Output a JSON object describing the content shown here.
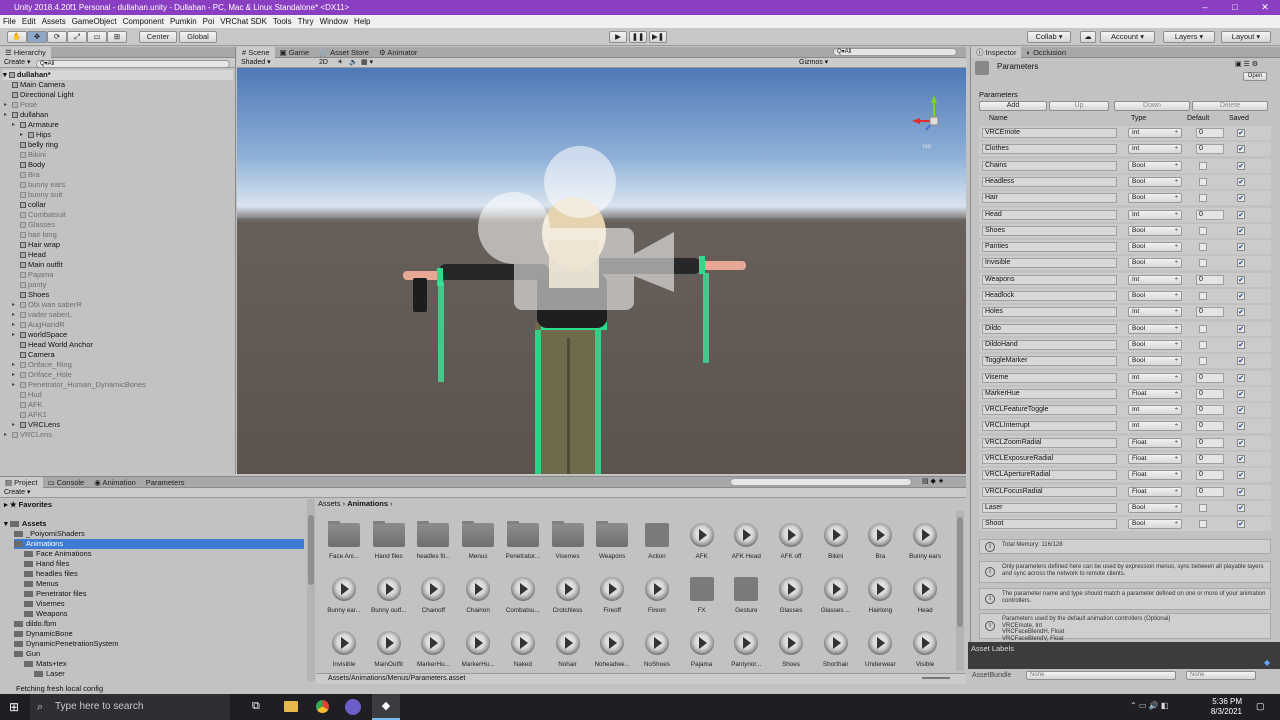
{
  "window": {
    "title": "Unity 2018.4.20f1 Personal - dullahan.unity - Dullahan - PC, Mac & Linux Standalone* <DX11>"
  },
  "menu": [
    "File",
    "Edit",
    "Assets",
    "GameObject",
    "Component",
    "Pumkin",
    "Poi",
    "VRChat SDK",
    "Tools",
    "Thry",
    "Window",
    "Help"
  ],
  "toolbar": {
    "center": "Center",
    "global": "Global",
    "collab": "Collab ▾",
    "account": "Account",
    "layers": "Layers",
    "layout": "Layout"
  },
  "hierarchy": {
    "tab": "Hierarchy",
    "create": "Create",
    "search": "Q▾All",
    "scene": "dullahan*",
    "items": [
      {
        "label": "Main Camera",
        "indent": 1,
        "dim": false,
        "arrow": false
      },
      {
        "label": "Directional Light",
        "indent": 1,
        "dim": false,
        "arrow": false
      },
      {
        "label": "Pose",
        "indent": 1,
        "dim": true,
        "arrow": true
      },
      {
        "label": "dullahan",
        "indent": 1,
        "dim": false,
        "arrow": true
      },
      {
        "label": "Armature",
        "indent": 2,
        "dim": false,
        "arrow": true
      },
      {
        "label": "Hips",
        "indent": 3,
        "dim": false,
        "arrow": true
      },
      {
        "label": "belly ring",
        "indent": 2,
        "dim": false,
        "arrow": false
      },
      {
        "label": "Bikini",
        "indent": 2,
        "dim": true,
        "arrow": false
      },
      {
        "label": "Body",
        "indent": 2,
        "dim": false,
        "arrow": false
      },
      {
        "label": "Bra",
        "indent": 2,
        "dim": true,
        "arrow": false
      },
      {
        "label": "bunny ears",
        "indent": 2,
        "dim": true,
        "arrow": false
      },
      {
        "label": "bunny suit",
        "indent": 2,
        "dim": true,
        "arrow": false
      },
      {
        "label": "collar",
        "indent": 2,
        "dim": false,
        "arrow": false
      },
      {
        "label": "Combatsuit",
        "indent": 2,
        "dim": true,
        "arrow": false
      },
      {
        "label": "Glasses",
        "indent": 2,
        "dim": true,
        "arrow": false
      },
      {
        "label": "hair long",
        "indent": 2,
        "dim": true,
        "arrow": false
      },
      {
        "label": "Hair wrap",
        "indent": 2,
        "dim": false,
        "arrow": false
      },
      {
        "label": "Head",
        "indent": 2,
        "dim": false,
        "arrow": false
      },
      {
        "label": "Main outfit",
        "indent": 2,
        "dim": false,
        "arrow": false
      },
      {
        "label": "Pajama",
        "indent": 2,
        "dim": true,
        "arrow": false
      },
      {
        "label": "panty",
        "indent": 2,
        "dim": true,
        "arrow": false
      },
      {
        "label": "Shoes",
        "indent": 2,
        "dim": false,
        "arrow": false
      },
      {
        "label": "Obi wan saberR",
        "indent": 2,
        "dim": true,
        "arrow": true
      },
      {
        "label": "vader saberL",
        "indent": 2,
        "dim": true,
        "arrow": true
      },
      {
        "label": "AugHandR",
        "indent": 2,
        "dim": true,
        "arrow": true
      },
      {
        "label": "worldSpace",
        "indent": 2,
        "dim": false,
        "arrow": true
      },
      {
        "label": "Head World Anchor",
        "indent": 2,
        "dim": false,
        "arrow": false
      },
      {
        "label": "Camera",
        "indent": 2,
        "dim": false,
        "arrow": false
      },
      {
        "label": "Oriface_Ring",
        "indent": 2,
        "dim": true,
        "arrow": true
      },
      {
        "label": "Oriface_Hole",
        "indent": 2,
        "dim": true,
        "arrow": true
      },
      {
        "label": "Penetrator_Human_DynamicBones",
        "indent": 2,
        "dim": true,
        "arrow": true
      },
      {
        "label": "Hud",
        "indent": 2,
        "dim": true,
        "arrow": false
      },
      {
        "label": "AFK",
        "indent": 2,
        "dim": true,
        "arrow": false
      },
      {
        "label": "AFK1",
        "indent": 2,
        "dim": true,
        "arrow": false
      },
      {
        "label": "VRCLens",
        "indent": 2,
        "dim": false,
        "arrow": true
      },
      {
        "label": "VRCLens",
        "indent": 1,
        "dim": true,
        "arrow": true
      }
    ]
  },
  "scene": {
    "tabs": [
      "Scene",
      "Game",
      "Asset Store",
      "Animator"
    ],
    "shaded": "Shaded",
    "mode2d": "2D",
    "gizmos": "Gizmos ▾",
    "search": "Q▾All",
    "persp": "Iso"
  },
  "inspector": {
    "tabs": [
      "Inspector",
      "Occlusion"
    ],
    "object_name": "Parameters",
    "open": "Open",
    "section": "Parameters",
    "buttons": {
      "add": "Add",
      "up": "Up",
      "down": "Down",
      "delete": "Delete"
    },
    "headers": {
      "name": "Name",
      "type": "Type",
      "default": "Default",
      "saved": "Saved"
    },
    "params": [
      {
        "name": "VRCEmote",
        "type": "Int",
        "default": "0"
      },
      {
        "name": "Clothes",
        "type": "Int",
        "default": "0"
      },
      {
        "name": "Chains",
        "type": "Bool",
        "default": ""
      },
      {
        "name": "Headless",
        "type": "Bool",
        "default": ""
      },
      {
        "name": "Hair",
        "type": "Bool",
        "default": ""
      },
      {
        "name": "Head",
        "type": "Int",
        "default": "0"
      },
      {
        "name": "Shoes",
        "type": "Bool",
        "default": ""
      },
      {
        "name": "Panties",
        "type": "Bool",
        "default": ""
      },
      {
        "name": "Invisible",
        "type": "Bool",
        "default": ""
      },
      {
        "name": "Weapons",
        "type": "Int",
        "default": "0"
      },
      {
        "name": "Headlock",
        "type": "Bool",
        "default": ""
      },
      {
        "name": "Holes",
        "type": "Int",
        "default": "0"
      },
      {
        "name": "Dildo",
        "type": "Bool",
        "default": ""
      },
      {
        "name": "DildoHand",
        "type": "Bool",
        "default": ""
      },
      {
        "name": "ToggleMarker",
        "type": "Bool",
        "default": ""
      },
      {
        "name": "Viseme",
        "type": "Int",
        "default": "0"
      },
      {
        "name": "MarkerHue",
        "type": "Float",
        "default": "0"
      },
      {
        "name": "VRCLFeatureToggle",
        "type": "Int",
        "default": "0"
      },
      {
        "name": "VRCLInterrupt",
        "type": "Int",
        "default": "0"
      },
      {
        "name": "VRCLZoomRadial",
        "type": "Float",
        "default": "0"
      },
      {
        "name": "VRCLExposureRadial",
        "type": "Float",
        "default": "0"
      },
      {
        "name": "VRCLApertureRadial",
        "type": "Float",
        "default": "0"
      },
      {
        "name": "VRCLFocusRadial",
        "type": "Float",
        "default": "0"
      },
      {
        "name": "Laser",
        "type": "Bool",
        "default": ""
      },
      {
        "name": "Shoot",
        "type": "Bool",
        "default": ""
      }
    ],
    "memory": "Total Memory: 116/128",
    "help1": "Only parameters defined here can be used by expression menus, sync between all playable layers and sync across the network to remote clients.",
    "help2": "The parameter name and type should match a parameter defined on one or more of your animation controllers.",
    "help3_title": "Parameters used by the default animation controllers (Optional)",
    "help3_lines": [
      "VRCEmote, Int",
      "VRCFaceBlendH, Float",
      "VRCFaceBlendV, Float"
    ],
    "asset_labels": "Asset Labels",
    "asset_bundle": "AssetBundle",
    "bundle_none": "None",
    "bundle_none2": "None"
  },
  "project": {
    "tabs": [
      "Project",
      "Console",
      "Animation",
      "Parameters"
    ],
    "create": "Create",
    "favorites": "Favorites",
    "assets_root": "Assets",
    "tree": [
      {
        "label": "_PoiyomiShaders",
        "indent": 1
      },
      {
        "label": "Animations",
        "indent": 1
      },
      {
        "label": "Face Animations",
        "indent": 2
      },
      {
        "label": "Hand files",
        "indent": 2
      },
      {
        "label": "headles files",
        "indent": 2
      },
      {
        "label": "Menus",
        "indent": 2
      },
      {
        "label": "Penetrator files",
        "indent": 2
      },
      {
        "label": "Visemes",
        "indent": 2
      },
      {
        "label": "Weapons",
        "indent": 2
      },
      {
        "label": "dildo.fbm",
        "indent": 1
      },
      {
        "label": "DynamicBone",
        "indent": 1
      },
      {
        "label": "DynamicPenetrationSystem",
        "indent": 1
      },
      {
        "label": "Gun",
        "indent": 1
      },
      {
        "label": "Mats+tex",
        "indent": 2
      },
      {
        "label": "Laser",
        "indent": 3
      }
    ],
    "breadcrumb": [
      "Assets",
      "Animations"
    ],
    "assets": [
      {
        "label": "Face Ani...",
        "kind": "folder"
      },
      {
        "label": "Hand files",
        "kind": "folder"
      },
      {
        "label": "headles fil...",
        "kind": "folder"
      },
      {
        "label": "Menus",
        "kind": "folder"
      },
      {
        "label": "Penetrator...",
        "kind": "folder"
      },
      {
        "label": "Visemes",
        "kind": "folder"
      },
      {
        "label": "Weapons",
        "kind": "folder"
      },
      {
        "label": "Action",
        "kind": "controller"
      },
      {
        "label": "AFK",
        "kind": "anim"
      },
      {
        "label": "AFK Head",
        "kind": "anim"
      },
      {
        "label": "AFK off",
        "kind": "anim"
      },
      {
        "label": "Bikini",
        "kind": "anim"
      },
      {
        "label": "Bra",
        "kind": "anim"
      },
      {
        "label": "Bunny ears",
        "kind": "anim"
      },
      {
        "label": "Bunny ear...",
        "kind": "anim"
      },
      {
        "label": "Bunny outf...",
        "kind": "anim"
      },
      {
        "label": "Chainoff",
        "kind": "anim"
      },
      {
        "label": "Chainon",
        "kind": "anim"
      },
      {
        "label": "Combatsu...",
        "kind": "anim"
      },
      {
        "label": "Crotchless",
        "kind": "anim"
      },
      {
        "label": "Fireoff",
        "kind": "anim"
      },
      {
        "label": "Fireon",
        "kind": "anim"
      },
      {
        "label": "FX",
        "kind": "controller"
      },
      {
        "label": "Gesture",
        "kind": "controller"
      },
      {
        "label": "Glasses",
        "kind": "anim"
      },
      {
        "label": "Glasses ...",
        "kind": "anim"
      },
      {
        "label": "Hairlong",
        "kind": "anim"
      },
      {
        "label": "Head",
        "kind": "anim"
      },
      {
        "label": "Invisible",
        "kind": "anim"
      },
      {
        "label": "MainOutfit",
        "kind": "anim"
      },
      {
        "label": "MarkerHu...",
        "kind": "anim"
      },
      {
        "label": "MarkerHu...",
        "kind": "anim"
      },
      {
        "label": "Naked",
        "kind": "anim"
      },
      {
        "label": "Nohair",
        "kind": "anim"
      },
      {
        "label": "Noheadwe...",
        "kind": "anim"
      },
      {
        "label": "NoShoes",
        "kind": "anim"
      },
      {
        "label": "Pajama",
        "kind": "anim"
      },
      {
        "label": "Pantynor...",
        "kind": "anim"
      },
      {
        "label": "Shoes",
        "kind": "anim"
      },
      {
        "label": "Shorthair",
        "kind": "anim"
      },
      {
        "label": "Underwear",
        "kind": "anim"
      },
      {
        "label": "Visible",
        "kind": "anim"
      }
    ],
    "path": "Assets/Animations/Menus/Parameters.asset"
  },
  "status": {
    "text": "Fetching fresh local config"
  },
  "taskbar": {
    "search": "Type here to search",
    "time": "5:36 PM",
    "date": "8/3/2021"
  }
}
